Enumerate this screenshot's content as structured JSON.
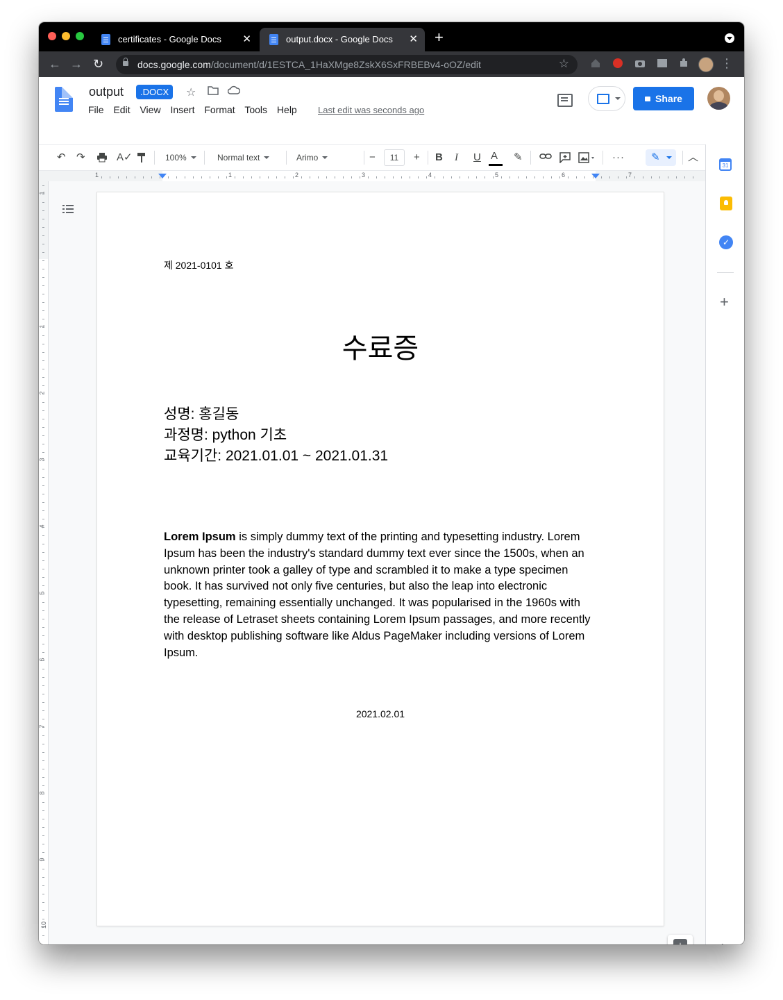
{
  "browser": {
    "tabs": [
      {
        "title": "certificates - Google Docs",
        "active": false
      },
      {
        "title": "output.docx - Google Docs",
        "active": true
      }
    ],
    "url_host": "docs.google.com",
    "url_path": "/document/d/1ESTCA_1HaXMge8ZskX6SxFRBEBv4-oOZ/edit"
  },
  "docs": {
    "title": "output",
    "badge": ".DOCX",
    "menu": [
      "File",
      "Edit",
      "View",
      "Insert",
      "Format",
      "Tools",
      "Help"
    ],
    "last_edit": "Last edit was seconds ago",
    "share_label": "Share"
  },
  "toolbar": {
    "zoom": "100%",
    "style": "Normal text",
    "font": "Arimo",
    "font_size": "11"
  },
  "ruler": {
    "h_labels": [
      "1",
      "1",
      "2",
      "3",
      "4",
      "5",
      "6",
      "7"
    ],
    "v_labels": [
      "1",
      "1",
      "2",
      "3",
      "4",
      "5",
      "6",
      "7",
      "8",
      "9",
      "10"
    ]
  },
  "document": {
    "doc_number": "제 2021-0101 호",
    "title": "수료증",
    "name_line": "성명: 홍길동",
    "course_line": "과정명: python 기초",
    "period_line": "교육기간: 2021.01.01 ~ 2021.01.31",
    "body_bold": "Lorem Ipsum",
    "body_rest": " is simply dummy text of the printing and typesetting industry. Lorem Ipsum has been the industry's standard dummy text ever since the 1500s, when an unknown printer took a galley of type and scrambled it to make a type specimen book. It has survived not only five centuries, but also the leap into electronic typesetting, remaining essentially unchanged. It was popularised in the 1960s with the release of Letraset sheets containing Lorem Ipsum passages, and more recently with desktop publishing software like Aldus PageMaker including versions of Lorem Ipsum.",
    "date": "2021.02.01"
  },
  "side_panel": {
    "calendar_day": "31"
  },
  "colors": {
    "accent": "#1a73e8",
    "docs_blue": "#4285f4",
    "keep_yellow": "#fbbc04"
  }
}
